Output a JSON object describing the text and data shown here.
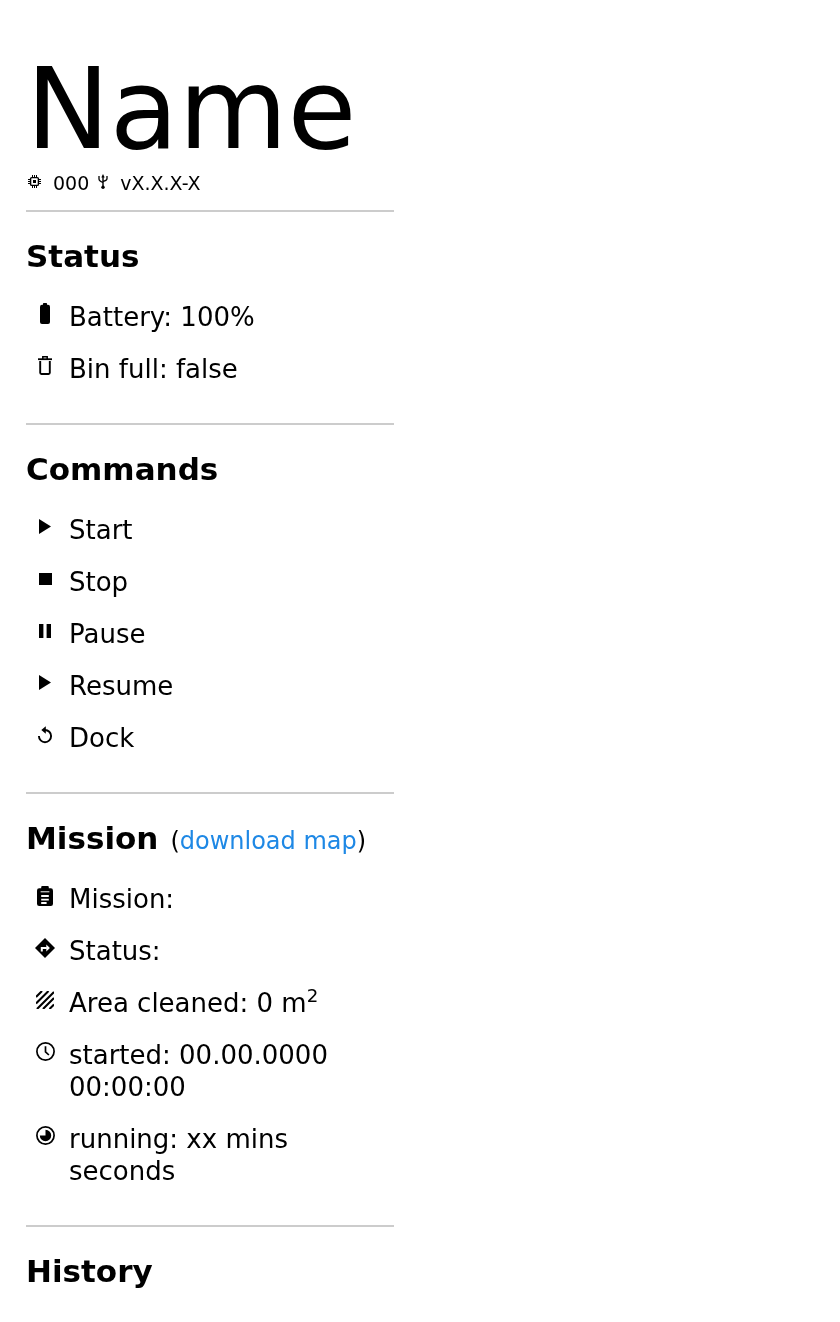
{
  "header": {
    "title": "Name",
    "meta": [
      {
        "kind": "chip",
        "text": "000"
      },
      {
        "kind": "usb",
        "text": "vX.X.X-X"
      }
    ]
  },
  "status": {
    "title": "Status",
    "items": [
      {
        "kind": "battery",
        "text": "Battery: 100%"
      },
      {
        "kind": "trash",
        "text": "Bin full: false"
      }
    ]
  },
  "commands": {
    "title": "Commands",
    "items": [
      {
        "kind": "play",
        "label": "Start"
      },
      {
        "kind": "stop",
        "label": "Stop"
      },
      {
        "kind": "pause",
        "label": "Pause"
      },
      {
        "kind": "play",
        "label": "Resume"
      },
      {
        "kind": "rotate",
        "label": "Dock"
      }
    ]
  },
  "mission": {
    "title": "Mission",
    "link": {
      "open": "(",
      "label": "download map",
      "close": ")"
    },
    "items": [
      {
        "kind": "clipboard",
        "text": "Mission:"
      },
      {
        "kind": "direction",
        "text": "Status:"
      },
      {
        "kind": "hatch",
        "text": "Area cleaned: 0 m$^{2}$"
      },
      {
        "kind": "clock",
        "text": "started: 00.00.0000 00:00:00"
      },
      {
        "kind": "pie",
        "text": "running: xx mins seconds"
      }
    ]
  },
  "history": {
    "title": "History"
  }
}
